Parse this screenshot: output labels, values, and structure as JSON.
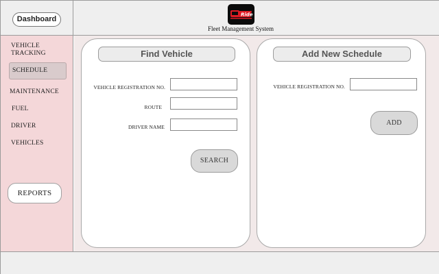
{
  "header": {
    "dashboard_label": "Dashboard",
    "system_title": "Fleet Management System",
    "logo_text": "Ride"
  },
  "sidebar": {
    "items": [
      {
        "label": "Vehicle Tracking",
        "line1": "Vehicle",
        "line2": "Tracking"
      },
      {
        "label": "Schedule",
        "active": true
      },
      {
        "label": "Maintenance"
      },
      {
        "label": "Fuel"
      },
      {
        "label": "Driver"
      },
      {
        "label": "Vehicles"
      }
    ],
    "reports_label": "Reports"
  },
  "find_vehicle": {
    "title": "Find Vehicle",
    "fields": [
      {
        "label": "Vehicle Registration No.",
        "value": ""
      },
      {
        "label": "Route",
        "value": ""
      },
      {
        "label": "Driver Name",
        "value": ""
      }
    ],
    "search_label": "Search"
  },
  "add_schedule": {
    "title": "Add New Schedule",
    "fields": [
      {
        "label": "Vehicle Registration No.",
        "value": ""
      }
    ],
    "add_label": "Add"
  },
  "colors": {
    "sidebar_bg": "#f4d7d9",
    "main_bg": "#f2e9e9",
    "header_bg": "#efefef",
    "logo_bg": "#0b0b0b",
    "logo_accent": "#e01b24"
  }
}
